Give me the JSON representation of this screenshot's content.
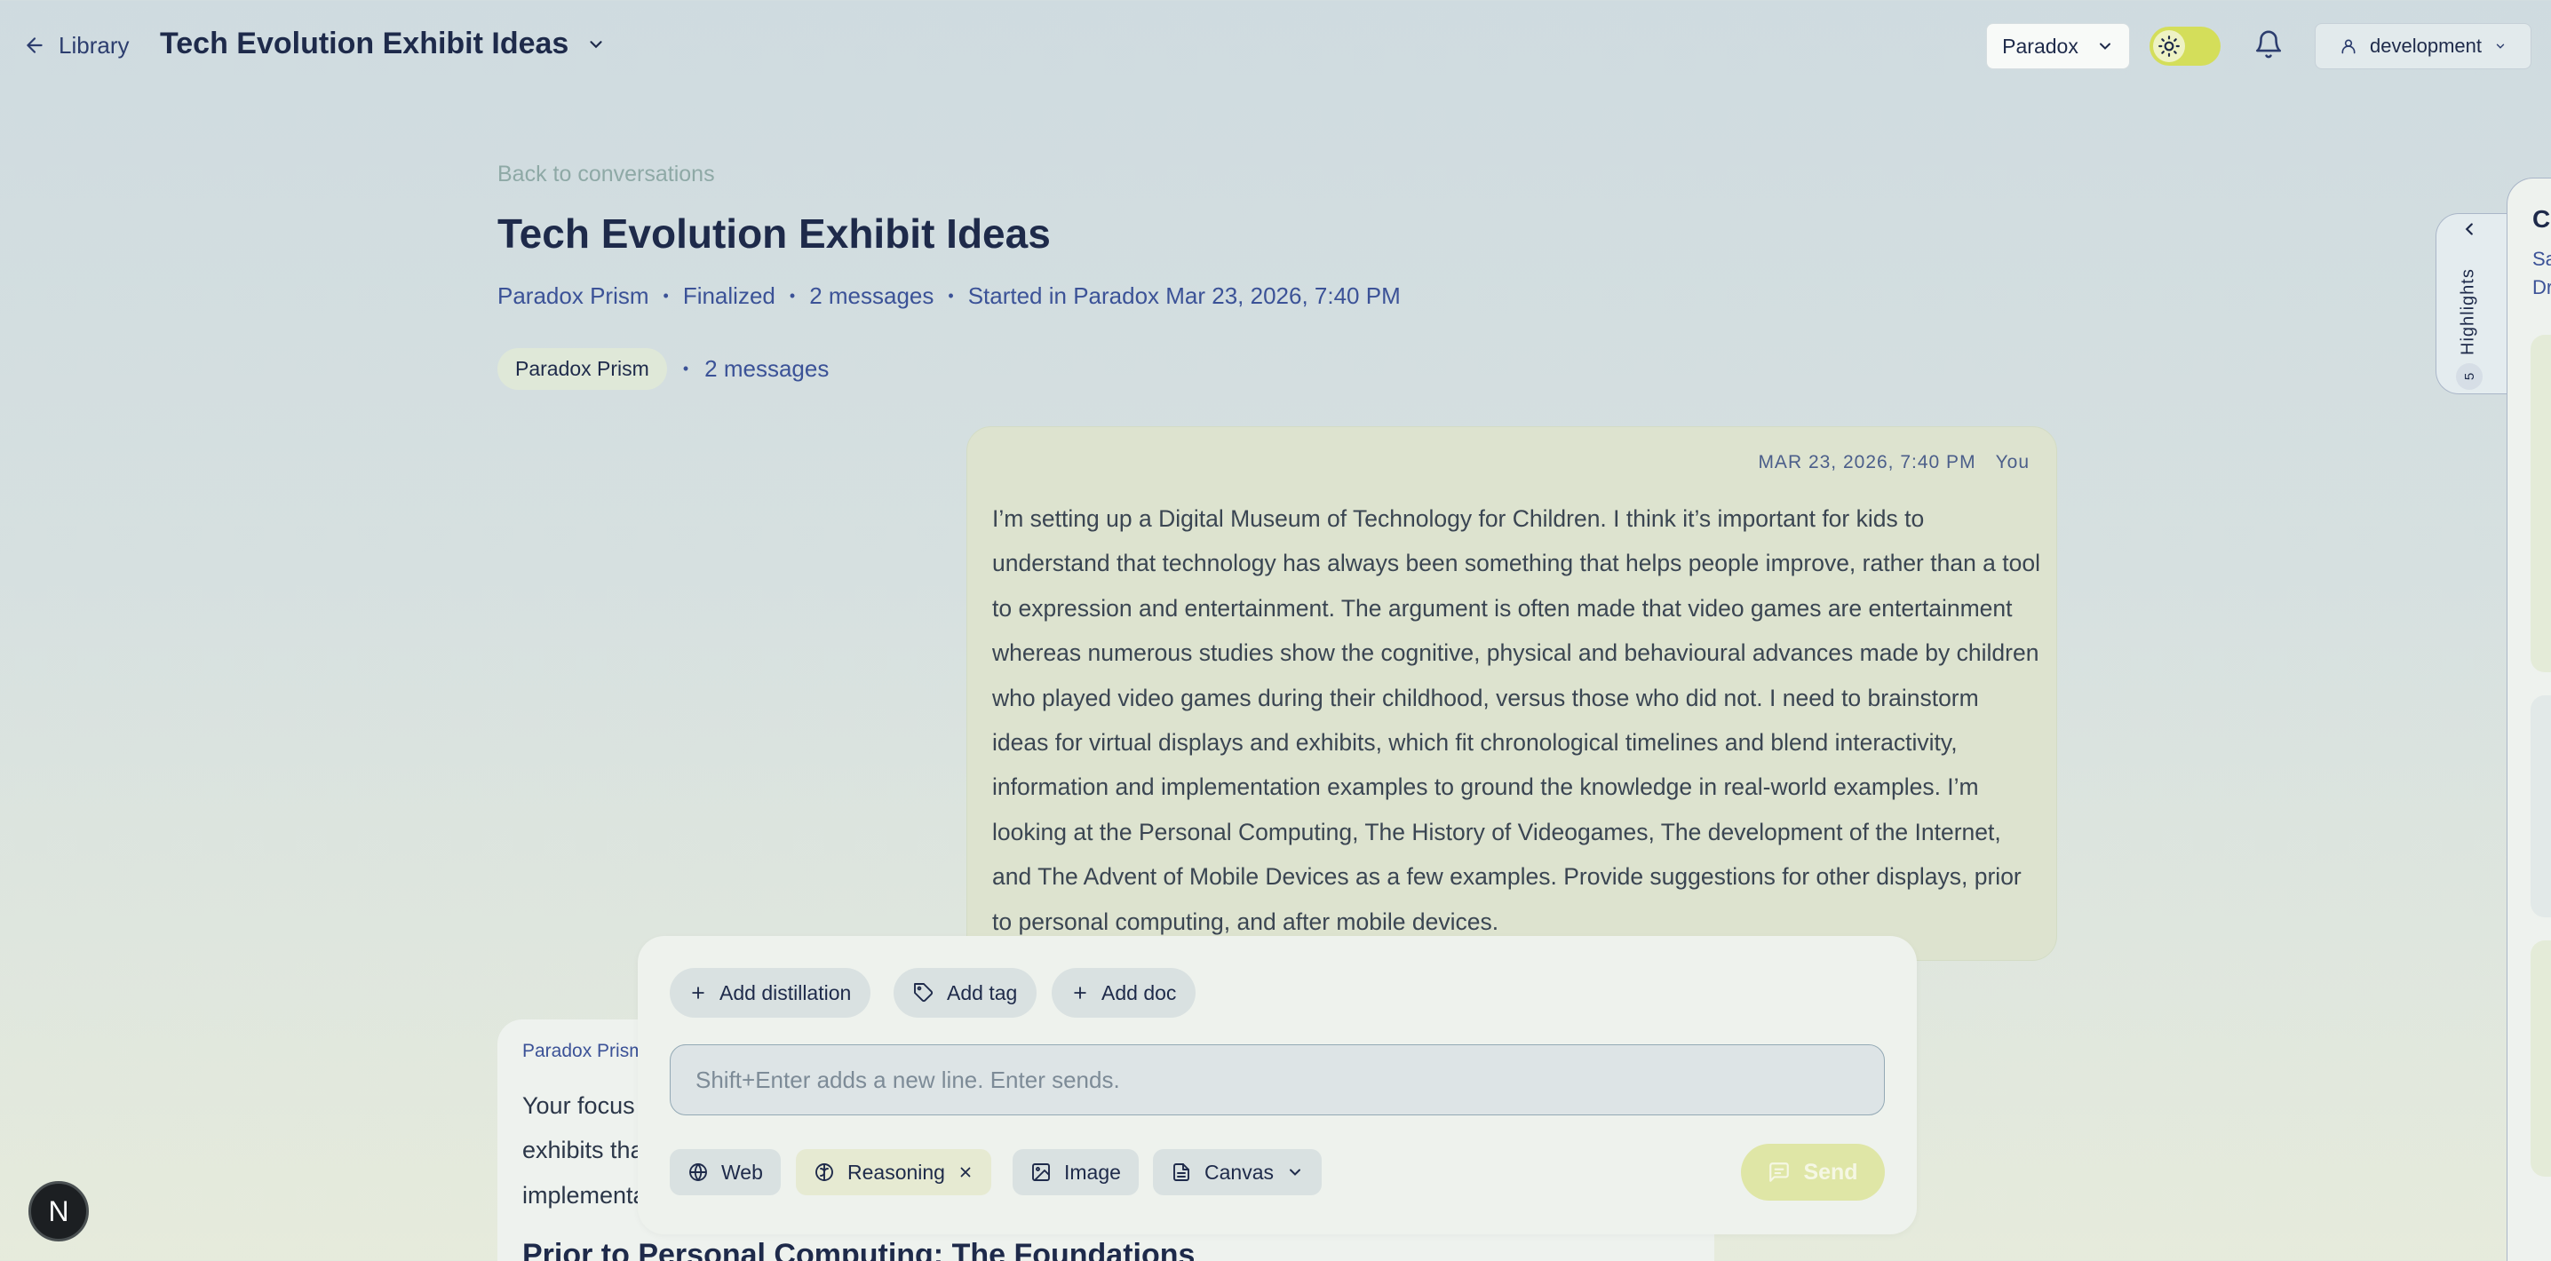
{
  "topbar": {
    "back_label": "Library",
    "title": "Tech Evolution Exhibit Ideas",
    "model_select": "Paradox",
    "account_select": "development"
  },
  "conversation": {
    "back_link": "Back to conversations",
    "title": "Tech Evolution Exhibit Ideas",
    "meta": {
      "model": "Paradox Prism",
      "status": "Finalized",
      "count": "2 messages",
      "started": "Started in Paradox Mar 23, 2026, 7:40 PM"
    },
    "chip_model": "Paradox Prism",
    "chip_count": "2 messages"
  },
  "user_message": {
    "timestamp": "MAR 23, 2026, 7:40 PM",
    "author": "You",
    "lines": [
      "I’m setting up a Digital Museum of Technology for Children. I think it’s important for kids to",
      "understand that technology has always been something that helps people improve, rather than a tool",
      "to expression and entertainment. The argument is often made that video games are entertainment",
      "whereas numerous studies show the cognitive, physical and behavioural advances made by children",
      "who played video games during their childhood, versus those who did not. I need to brainstorm",
      "ideas for virtual displays and exhibits, which fit chronological timelines and blend interactivity,",
      "information and implementation examples to ground the knowledge in real-world examples.  I’m",
      "looking at the Personal Computing, The History of Videogames, The development of the Internet,",
      "and The Advent of Mobile Devices as a few examples. Provide suggestions for other displays, prior",
      "to personal computing, and after mobile devices."
    ]
  },
  "assistant_message": {
    "author": "Paradox Prism",
    "lines": [
      "Your focus",
      "exhibits tha",
      "implementat"
    ],
    "heading": "Prior to Personal Computing: The Foundations"
  },
  "composer": {
    "add_distillation": "Add distillation",
    "add_tag": "Add tag",
    "add_doc": "Add doc",
    "placeholder": "Shift+Enter adds a new line. Enter sends.",
    "tools": {
      "web": "Web",
      "reasoning": "Reasoning",
      "image": "Image",
      "canvas": "Canvas"
    },
    "send": "Send"
  },
  "side_panel": {
    "highlights_label": "Highlights",
    "highlights_count": "5",
    "title": "Ca",
    "line1": "Sa",
    "line2": "Dr"
  },
  "avatar_initial": "N",
  "colors": {
    "accent_link": "#3b5297",
    "toggle": "#d4de5a",
    "send": "#dfe6a6",
    "user_bubble": "#dde3cf"
  }
}
